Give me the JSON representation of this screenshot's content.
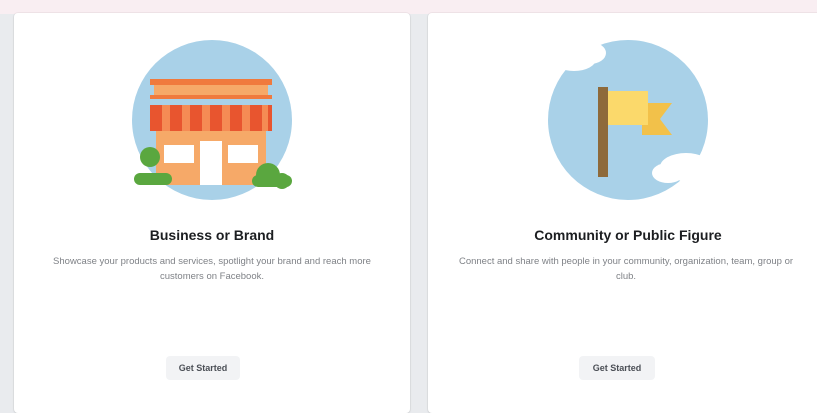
{
  "cards": [
    {
      "title": "Business or Brand",
      "description": "Showcase your products and services, spotlight your brand and reach more customers on Facebook.",
      "button_label": "Get Started",
      "illustration_icon": "storefront-icon"
    },
    {
      "title": "Community or Public Figure",
      "description": "Connect and share with people in your community, organization, team, group or club.",
      "button_label": "Get Started",
      "illustration_icon": "flag-icon"
    }
  ],
  "colors": {
    "page_background": "#e9ebee",
    "card_background": "#ffffff",
    "illustration_sky": "#a9d1e8",
    "awning_red": "#e8552f",
    "storefront_orange": "#f6a968",
    "bush_green": "#5aa73f",
    "flag_yellow": "#fbd96b",
    "pole_brown": "#8e6a3b"
  }
}
